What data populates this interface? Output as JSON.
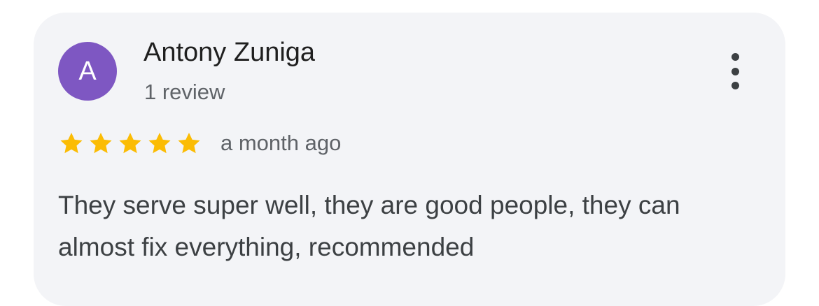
{
  "review": {
    "author_initial": "A",
    "author_name": "Antony Zuniga",
    "author_review_count": "1 review",
    "rating": 5,
    "rating_max": 5,
    "time": "a month ago",
    "text": "They serve super well, they are good people, they can almost fix everything, recommended",
    "menu_icon": "more-vert-icon"
  },
  "colors": {
    "avatar_bg": "#7e57c2",
    "star": "#fbbc04",
    "card_bg": "#f3f4f7"
  }
}
